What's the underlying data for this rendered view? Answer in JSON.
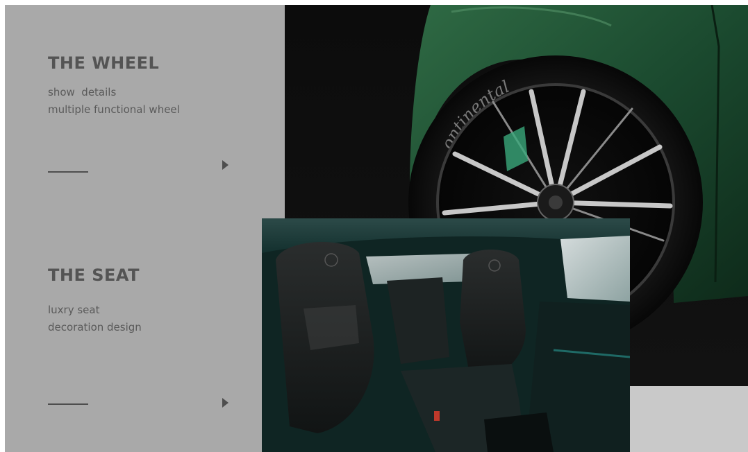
{
  "wheel_section": {
    "title": "THE WHEEL",
    "desc_line1": "show  details",
    "desc_line2": "multiple functional wheel"
  },
  "seat_section": {
    "title": "THE SEAT",
    "desc_line1": "luxry seat",
    "desc_line2": "decoration design"
  },
  "tire_brand": "ontinental",
  "icons": {
    "wheel_arrow": "play-arrow-icon",
    "seat_arrow": "play-arrow-icon"
  },
  "colors": {
    "panel": "#a9a9a9",
    "text": "#545454",
    "car_green": "#1e4a30",
    "interior_teal": "#1f3a38"
  }
}
